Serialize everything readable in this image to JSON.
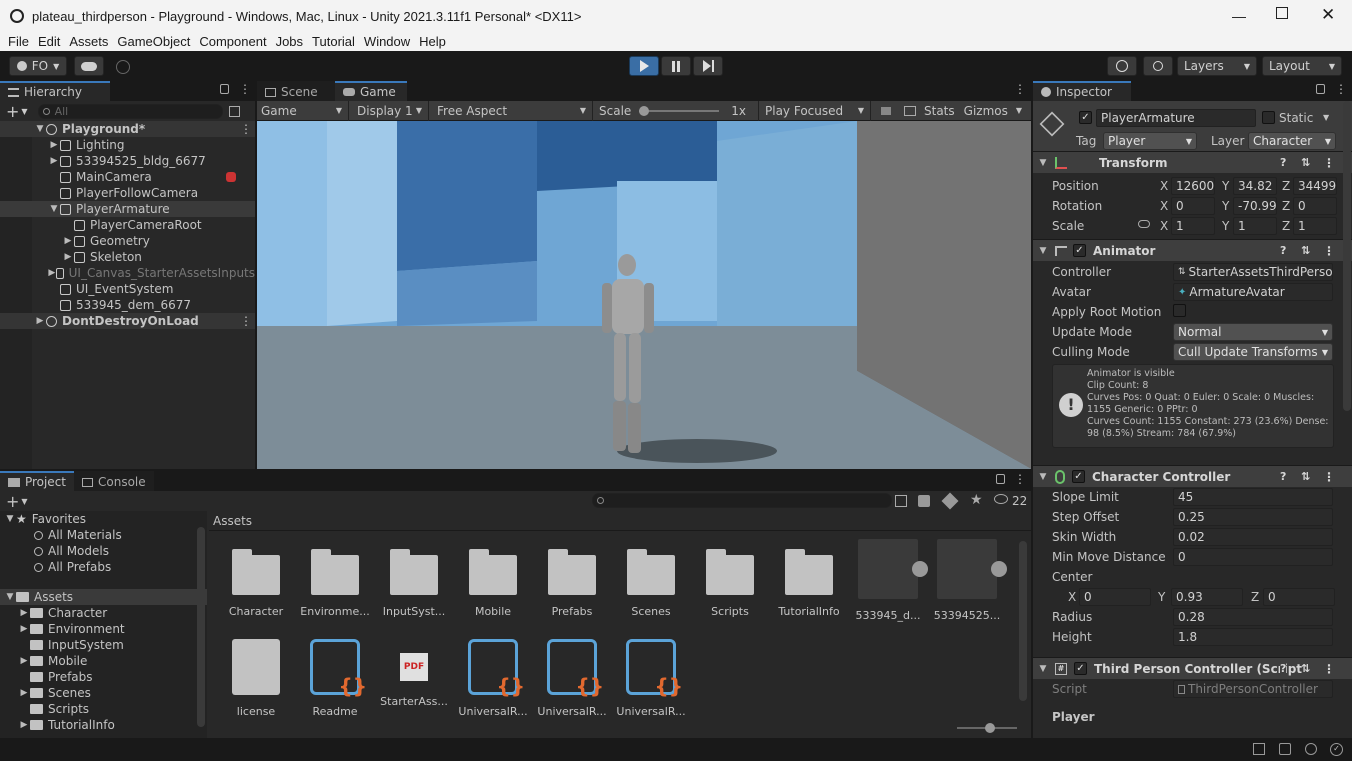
{
  "window": {
    "title": "plateau_thirdperson - Playground - Windows, Mac, Linux - Unity 2021.3.11f1 Personal* <DX11>"
  },
  "menu": [
    "File",
    "Edit",
    "Assets",
    "GameObject",
    "Component",
    "Jobs",
    "Tutorial",
    "Window",
    "Help"
  ],
  "toolbar": {
    "account": "FO",
    "layers": "Layers",
    "layout": "Layout"
  },
  "hierarchy": {
    "tab": "Hierarchy",
    "search_placeholder": "All",
    "rows": [
      {
        "label": "Playground*",
        "indent": 0,
        "arrow": "▼",
        "scene": true
      },
      {
        "label": "Lighting",
        "indent": 1,
        "arrow": "▶"
      },
      {
        "label": "53394525_bldg_6677",
        "indent": 1,
        "arrow": "▶"
      },
      {
        "label": "MainCamera",
        "indent": 1,
        "arrow": ""
      },
      {
        "label": "PlayerFollowCamera",
        "indent": 1,
        "arrow": ""
      },
      {
        "label": "PlayerArmature",
        "indent": 1,
        "arrow": "▼",
        "selected": true
      },
      {
        "label": "PlayerCameraRoot",
        "indent": 2,
        "arrow": ""
      },
      {
        "label": "Geometry",
        "indent": 2,
        "arrow": "▶"
      },
      {
        "label": "Skeleton",
        "indent": 2,
        "arrow": "▶"
      },
      {
        "label": "UI_Canvas_StarterAssetsInputs",
        "indent": 1,
        "arrow": "▶",
        "dim": true
      },
      {
        "label": "UI_EventSystem",
        "indent": 1,
        "arrow": ""
      },
      {
        "label": "533945_dem_6677",
        "indent": 1,
        "arrow": ""
      },
      {
        "label": "DontDestroyOnLoad",
        "indent": 0,
        "arrow": "▶",
        "scene": true
      }
    ]
  },
  "game": {
    "tabs": [
      "Scene",
      "Game"
    ],
    "mode": "Game",
    "display": "Display 1",
    "aspect": "Free Aspect",
    "scale_label": "Scale",
    "scale_value": "1x",
    "play_focus": "Play Focused",
    "stats": "Stats",
    "gizmos": "Gizmos"
  },
  "project": {
    "tabs": [
      "Project",
      "Console"
    ],
    "count": "22",
    "favorites_title": "Favorites",
    "favorites": [
      "All Materials",
      "All Models",
      "All Prefabs"
    ],
    "assets_title": "Assets",
    "tree": [
      {
        "label": "Character",
        "arrow": "▶"
      },
      {
        "label": "Environment",
        "arrow": "▶"
      },
      {
        "label": "InputSystem",
        "arrow": ""
      },
      {
        "label": "Mobile",
        "arrow": "▶"
      },
      {
        "label": "Prefabs",
        "arrow": ""
      },
      {
        "label": "Scenes",
        "arrow": "▶"
      },
      {
        "label": "Scripts",
        "arrow": ""
      },
      {
        "label": "TutorialInfo",
        "arrow": "▶"
      }
    ],
    "breadcrumb": "Assets",
    "grid_row1": [
      "Character",
      "Environme...",
      "InputSyst...",
      "Mobile",
      "Prefabs",
      "Scenes",
      "Scripts",
      "TutorialInfo",
      "533945_d...",
      "53394525..."
    ],
    "grid_row2": [
      "license",
      "Readme",
      "StarterAss...",
      "UniversalR...",
      "UniversalR...",
      "UniversalR..."
    ],
    "pdf_badge": "PDF"
  },
  "inspector": {
    "tab": "Inspector",
    "name": "PlayerArmature",
    "static_label": "Static",
    "tag_label": "Tag",
    "tag_value": "Player",
    "layer_label": "Layer",
    "layer_value": "Character",
    "transform": {
      "title": "Transform",
      "position_label": "Position",
      "position": [
        "12600",
        "34.82",
        "34499"
      ],
      "rotation_label": "Rotation",
      "rotation": [
        "0",
        "-70.99",
        "0"
      ],
      "scale_label": "Scale",
      "scale": [
        "1",
        "1",
        "1"
      ]
    },
    "animator": {
      "title": "Animator",
      "controller_label": "Controller",
      "controller": "StarterAssetsThirdPerson",
      "avatar_label": "Avatar",
      "avatar": "ArmatureAvatar",
      "apply_root_label": "Apply Root Motion",
      "update_label": "Update Mode",
      "update": "Normal",
      "culling_label": "Culling Mode",
      "culling": "Cull Update Transforms",
      "info": [
        "Animator is visible",
        "Clip Count: 8",
        "Curves Pos: 0 Quat: 0 Euler: 0 Scale: 0 Muscles:",
        "1155 Generic: 0 PPtr: 0",
        "Curves Count: 1155 Constant: 273 (23.6%) Dense:",
        "98 (8.5%) Stream: 784 (67.9%)"
      ]
    },
    "character_controller": {
      "title": "Character Controller",
      "slope_label": "Slope Limit",
      "slope": "45",
      "step_label": "Step Offset",
      "step": "0.25",
      "skin_label": "Skin Width",
      "skin": "0.02",
      "minmove_label": "Min Move Distance",
      "minmove": "0",
      "center_label": "Center",
      "center": [
        "0",
        "0.93",
        "0"
      ],
      "radius_label": "Radius",
      "radius": "0.28",
      "height_label": "Height",
      "height": "1.8"
    },
    "third_person": {
      "title": "Third Person Controller (Script",
      "script_label": "Script",
      "script": "ThirdPersonController",
      "player_label": "Player"
    }
  },
  "colors": {
    "accent": "#3a79bb",
    "panel": "#282828",
    "sky": "#7fb3d9"
  }
}
